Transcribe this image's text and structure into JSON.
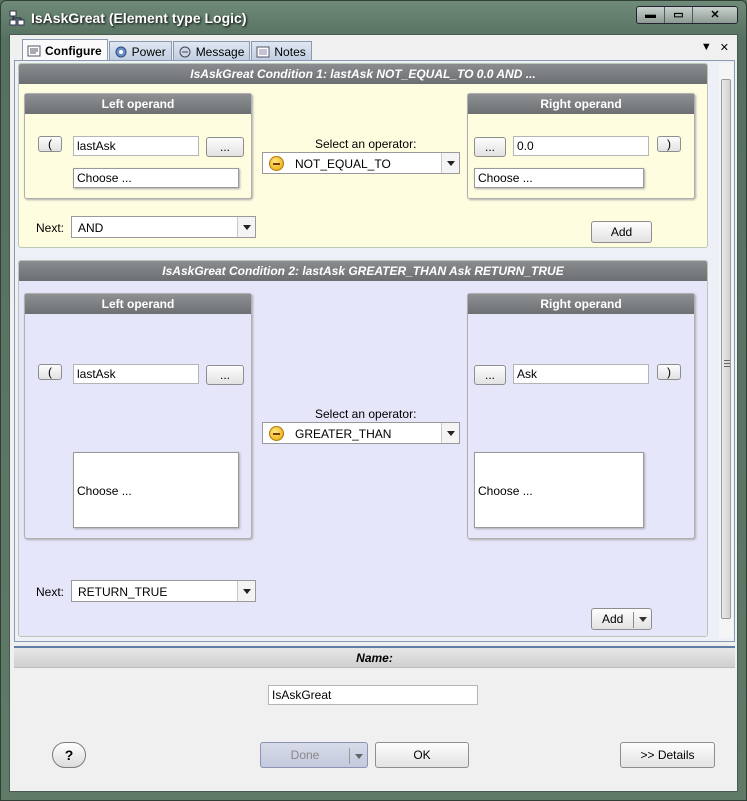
{
  "window": {
    "title": "IsAskGreat (Element type Logic)",
    "controls": {
      "minimize": "▬",
      "maximize": "▭",
      "close": "✕"
    }
  },
  "tabs": [
    {
      "label": "Configure",
      "icon": "configure-icon"
    },
    {
      "label": "Power",
      "icon": "power-icon"
    },
    {
      "label": "Message",
      "icon": "message-icon"
    },
    {
      "label": "Notes",
      "icon": "notes-icon"
    }
  ],
  "tabbar": {
    "dropdown": "▼",
    "close": "✕"
  },
  "conditions": [
    {
      "header": "IsAskGreat   Condition 1:   lastAsk NOT_EQUAL_TO 0.0   AND ...",
      "left": {
        "title": "Left operand",
        "open_paren": "(",
        "value": "lastAsk",
        "browse": "...",
        "choose": "Choose ..."
      },
      "operator_label": "Select an operator:",
      "operator": "NOT_EQUAL_TO",
      "right": {
        "title": "Right operand",
        "browse": "...",
        "value": "0.0",
        "close_paren": ")",
        "choose": "Choose ..."
      },
      "next_label": "Next:",
      "next": "AND",
      "add": "Add"
    },
    {
      "header": "IsAskGreat   Condition 2:   lastAsk GREATER_THAN Ask   RETURN_TRUE",
      "left": {
        "title": "Left operand",
        "open_paren": "(",
        "value": "lastAsk",
        "browse": "...",
        "choose": "Choose ..."
      },
      "operator_label": "Select an operator:",
      "operator": "GREATER_THAN",
      "right": {
        "title": "Right operand",
        "browse": "...",
        "value": "Ask",
        "close_paren": ")",
        "choose": "Choose ..."
      },
      "next_label": "Next:",
      "next": "RETURN_TRUE",
      "add": "Add"
    }
  ],
  "bottom": {
    "name_label": "Name:",
    "name_value": "IsAskGreat",
    "help": "?",
    "done": "Done",
    "ok": "OK",
    "details": ">> Details"
  }
}
